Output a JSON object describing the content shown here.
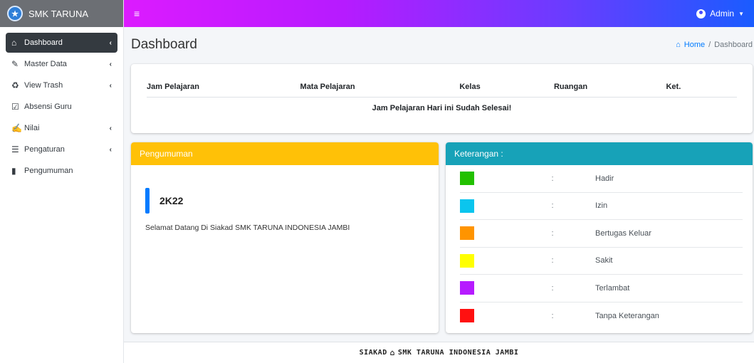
{
  "brand": {
    "name": "SMK TARUNA"
  },
  "sidebar": {
    "items": [
      {
        "label": "Dashboard",
        "icon": "home-icon",
        "glyph": "⌂",
        "chevron": "‹",
        "active": true
      },
      {
        "label": "Master Data",
        "icon": "edit-icon",
        "glyph": "✎",
        "chevron": "‹"
      },
      {
        "label": "View Trash",
        "icon": "recycle-icon",
        "glyph": "♻",
        "chevron": "‹"
      },
      {
        "label": "Absensi Guru",
        "icon": "calendar-check-icon",
        "glyph": "☑",
        "chevron": ""
      },
      {
        "label": "Nilai",
        "icon": "signature-icon",
        "glyph": "✍",
        "chevron": "‹"
      },
      {
        "label": "Pengaturan",
        "icon": "sliders-icon",
        "glyph": "☰",
        "chevron": "‹"
      },
      {
        "label": "Pengumuman",
        "icon": "clipboard-icon",
        "glyph": "▮",
        "chevron": ""
      }
    ]
  },
  "topbar": {
    "menu_glyph": "≡",
    "user_label": "Admin",
    "caret": "▼"
  },
  "header": {
    "title": "Dashboard"
  },
  "breadcrumb": {
    "home": "Home",
    "separator": "/",
    "current": "Dashboard"
  },
  "schedule": {
    "columns": [
      "Jam Pelajaran",
      "Mata Pelajaran",
      "Kelas",
      "Ruangan",
      "Ket."
    ],
    "message": "Jam Pelajaran Hari ini Sudah Selesai!"
  },
  "announcement": {
    "header": "Pengumuman",
    "title": "2K22",
    "text": "Selamat Datang Di Siakad SMK TARUNA INDONESIA JAMBI"
  },
  "legend": {
    "header": "Keterangan :",
    "items": [
      {
        "color": "#22c000",
        "sep": ":",
        "label": "Hadir"
      },
      {
        "color": "#0bc5ee",
        "sep": ":",
        "label": "Izin"
      },
      {
        "color": "#ff9400",
        "sep": ":",
        "label": "Bertugas Keluar"
      },
      {
        "color": "#ffff00",
        "sep": ":",
        "label": "Sakit"
      },
      {
        "color": "#b61bff",
        "sep": ":",
        "label": "Terlambat"
      },
      {
        "color": "#ff1010",
        "sep": ":",
        "label": "Tanpa Keterangan"
      }
    ]
  },
  "footer": {
    "left": "SIAKAD",
    "icon": "home-icon",
    "glyph": "⌂",
    "right": "SMK TARUNA INDONESIA JAMBI"
  },
  "colors": {
    "accent": "#007bff",
    "warning": "#ffc107",
    "info": "#17a2b8",
    "sidebar_active": "#343a40",
    "brand_bg": "#6c6f74"
  }
}
